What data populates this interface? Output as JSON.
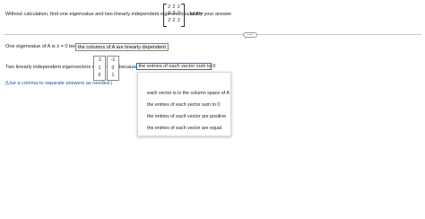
{
  "question": {
    "prompt": "Without calculation, find one eigenvalue and two linearly independent eigenvectors of A =",
    "suffix": ". Justify your answer.",
    "matrix": [
      [
        "2",
        "2",
        "2"
      ],
      [
        "2",
        "2",
        "2"
      ],
      [
        "2",
        "2",
        "2"
      ]
    ]
  },
  "answer1": {
    "prefix": "One eigenvalue of A is λ =",
    "value": "0",
    "because": "because",
    "reason": "the columns of A are linearly dependent"
  },
  "answer2": {
    "prefix": "Two linearly independent eigenvectors of A are",
    "vector1": [
      "-1",
      "1",
      "0"
    ],
    "vector2": [
      "-1",
      "0",
      "1"
    ],
    "because": "because",
    "selected": "the entries of each vector sum to 0"
  },
  "hint": "(Use a comma to separate answers as needed.)",
  "dropdown_options": [
    "each vector is in the column space of A",
    "the entries of each vector sum to 0",
    "the entries of each vector are positive",
    "the entries of each vector are equal"
  ]
}
